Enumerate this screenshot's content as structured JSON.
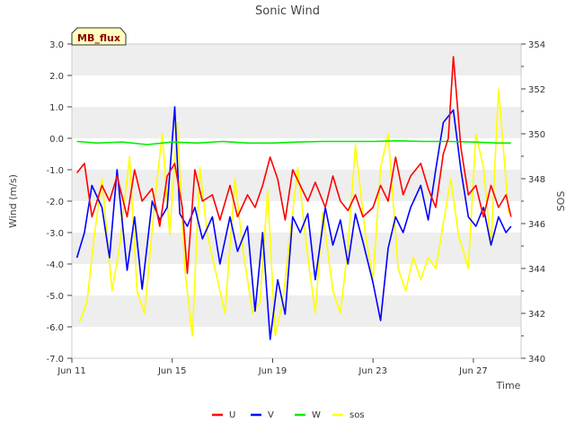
{
  "chart_data": {
    "type": "line",
    "title": "Sonic Wind",
    "xlabel": "Time",
    "ylabel": "Wind (m/s)",
    "y2label": "SOS",
    "badge": "MB_flux",
    "x_ticks": [
      "Jun 11",
      "Jun 15",
      "Jun 19",
      "Jun 23",
      "Jun 27"
    ],
    "x_tick_days": [
      11,
      15,
      19,
      23,
      27
    ],
    "xlim_days": [
      11,
      28.9
    ],
    "ylim": [
      -7.0,
      3.0
    ],
    "y_ticks": [
      "3.0",
      "2.0",
      "1.0",
      "0.0",
      "-1.0",
      "-2.0",
      "-3.0",
      "-4.0",
      "-5.0",
      "-6.0",
      "-7.0"
    ],
    "y_tick_values": [
      3,
      2,
      1,
      0,
      -1,
      -2,
      -3,
      -4,
      -5,
      -6,
      -7
    ],
    "y2lim": [
      340,
      354
    ],
    "y2_ticks": [
      "354",
      "352",
      "350",
      "348",
      "346",
      "344",
      "342",
      "340"
    ],
    "y2_tick_values": [
      354,
      352,
      350,
      348,
      346,
      344,
      342,
      340
    ],
    "grid": "horizontal bands",
    "legend_position": "bottom-center",
    "series": [
      {
        "name": "U",
        "color": "#ff0000",
        "axis": "left",
        "x": [
          11.2,
          11.5,
          11.8,
          12.2,
          12.5,
          12.8,
          13.2,
          13.5,
          13.8,
          14.2,
          14.5,
          14.8,
          15.1,
          15.4,
          15.6,
          15.9,
          16.2,
          16.6,
          16.9,
          17.3,
          17.6,
          18.0,
          18.3,
          18.6,
          18.9,
          19.2,
          19.5,
          19.8,
          20.1,
          20.4,
          20.7,
          21.1,
          21.4,
          21.7,
          22.0,
          22.3,
          22.6,
          23.0,
          23.3,
          23.6,
          23.9,
          24.2,
          24.5,
          24.9,
          25.2,
          25.5,
          25.8,
          26.0,
          26.2,
          26.5,
          26.8,
          27.1,
          27.4,
          27.7,
          28.0,
          28.3,
          28.5
        ],
        "values": [
          -1.1,
          -0.8,
          -2.5,
          -1.5,
          -2.0,
          -1.2,
          -2.5,
          -1.0,
          -2.0,
          -1.6,
          -2.8,
          -1.2,
          -0.8,
          -2.2,
          -4.3,
          -1.0,
          -2.0,
          -1.8,
          -2.6,
          -1.5,
          -2.5,
          -1.8,
          -2.2,
          -1.5,
          -0.6,
          -1.3,
          -2.6,
          -1.0,
          -1.5,
          -2.0,
          -1.4,
          -2.2,
          -1.2,
          -2.0,
          -2.3,
          -1.8,
          -2.5,
          -2.2,
          -1.5,
          -2.0,
          -0.6,
          -1.8,
          -1.2,
          -0.8,
          -1.6,
          -2.2,
          -0.5,
          0.0,
          2.6,
          -0.3,
          -1.8,
          -1.5,
          -2.5,
          -1.5,
          -2.2,
          -1.8,
          -2.5
        ]
      },
      {
        "name": "V",
        "color": "#0000ff",
        "axis": "left",
        "x": [
          11.2,
          11.5,
          11.8,
          12.2,
          12.5,
          12.8,
          13.2,
          13.5,
          13.8,
          14.2,
          14.5,
          14.8,
          15.1,
          15.3,
          15.6,
          15.9,
          16.2,
          16.6,
          16.9,
          17.3,
          17.6,
          18.0,
          18.3,
          18.6,
          18.9,
          19.2,
          19.5,
          19.8,
          20.1,
          20.4,
          20.7,
          21.1,
          21.4,
          21.7,
          22.0,
          22.3,
          22.6,
          23.0,
          23.3,
          23.6,
          23.9,
          24.2,
          24.5,
          24.9,
          25.2,
          25.5,
          25.8,
          26.0,
          26.2,
          26.5,
          26.8,
          27.1,
          27.4,
          27.7,
          28.0,
          28.3,
          28.5
        ],
        "values": [
          -3.8,
          -3.0,
          -1.5,
          -2.2,
          -3.8,
          -1.0,
          -4.2,
          -2.5,
          -4.8,
          -2.0,
          -2.6,
          -2.2,
          1.0,
          -2.4,
          -2.8,
          -2.2,
          -3.2,
          -2.5,
          -4.0,
          -2.5,
          -3.6,
          -2.8,
          -5.5,
          -3.0,
          -6.4,
          -4.5,
          -5.6,
          -2.5,
          -3.0,
          -2.4,
          -4.5,
          -2.2,
          -3.4,
          -2.6,
          -4.0,
          -2.4,
          -3.3,
          -4.6,
          -5.8,
          -3.5,
          -2.5,
          -3.0,
          -2.2,
          -1.5,
          -2.6,
          -1.0,
          0.5,
          0.7,
          0.9,
          -1.0,
          -2.5,
          -2.8,
          -2.2,
          -3.4,
          -2.5,
          -3.0,
          -2.8
        ]
      },
      {
        "name": "W",
        "color": "#00ee00",
        "axis": "left",
        "x": [
          11.2,
          12.0,
          13.0,
          14.0,
          15.0,
          16.0,
          17.0,
          18.0,
          19.0,
          20.0,
          21.0,
          22.0,
          23.0,
          24.0,
          25.0,
          26.0,
          27.0,
          28.0,
          28.5
        ],
        "values": [
          -0.1,
          -0.15,
          -0.12,
          -0.2,
          -0.12,
          -0.15,
          -0.1,
          -0.15,
          -0.15,
          -0.12,
          -0.1,
          -0.1,
          -0.1,
          -0.08,
          -0.1,
          -0.1,
          -0.12,
          -0.15,
          -0.15
        ]
      },
      {
        "name": "sos",
        "color": "#ffff00",
        "axis": "right",
        "x": [
          11.3,
          11.6,
          11.9,
          12.2,
          12.6,
          12.9,
          13.3,
          13.6,
          13.9,
          14.3,
          14.6,
          14.9,
          15.2,
          15.5,
          15.8,
          16.1,
          16.4,
          16.8,
          17.1,
          17.5,
          17.8,
          18.2,
          18.5,
          18.8,
          19.1,
          19.4,
          19.7,
          20.0,
          20.4,
          20.7,
          21.0,
          21.4,
          21.7,
          22.0,
          22.3,
          22.7,
          23.0,
          23.3,
          23.6,
          24.0,
          24.3,
          24.6,
          24.9,
          25.2,
          25.5,
          25.8,
          26.1,
          26.4,
          26.8,
          27.1,
          27.4,
          27.7,
          28.0,
          28.4
        ],
        "values": [
          341.6,
          342.5,
          345.5,
          348.0,
          343.0,
          345.0,
          349.0,
          343.0,
          342.0,
          347.0,
          350.0,
          345.5,
          350.5,
          344.0,
          341.0,
          348.5,
          345.5,
          343.5,
          342.0,
          348.0,
          345.0,
          342.0,
          342.5,
          347.5,
          341.0,
          342.5,
          345.5,
          348.5,
          344.5,
          342.0,
          346.5,
          343.0,
          342.0,
          345.0,
          349.5,
          345.5,
          343.5,
          348.5,
          350.0,
          344.0,
          343.0,
          344.5,
          343.5,
          344.5,
          344.0,
          346.0,
          348.0,
          345.5,
          344.0,
          350.0,
          348.5,
          345.0,
          352.0,
          346.5
        ]
      }
    ]
  }
}
